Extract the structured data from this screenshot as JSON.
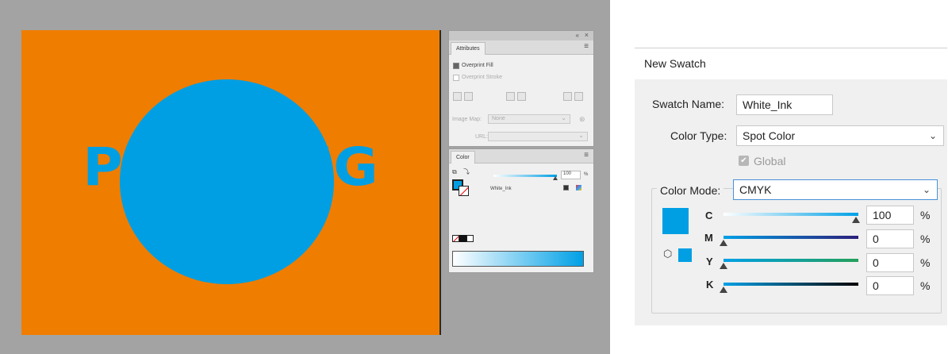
{
  "artwork": {
    "text": "PRINTING"
  },
  "attributes_panel": {
    "collapse_glyph": "«",
    "close_glyph": "×",
    "tab": "Attributes",
    "overprint_fill": "Overprint Fill",
    "overprint_stroke": "Overprint Stroke",
    "image_map_label": "Image Map:",
    "image_map_value": "None",
    "url_label": "URL:"
  },
  "color_panel": {
    "tab": "Color",
    "tint_value": "100",
    "tint_unit": "%",
    "swatch_name": "White_Ink"
  },
  "dialog": {
    "title": "New Swatch",
    "swatch_name_label": "Swatch Name:",
    "swatch_name_value": "White_Ink",
    "color_type_label": "Color Type:",
    "color_type_value": "Spot Color",
    "global_label": "Global",
    "color_mode_label": "Color Mode:",
    "color_mode_value": "CMYK",
    "channels": [
      {
        "label": "C",
        "value": "100",
        "unit": "%"
      },
      {
        "label": "M",
        "value": "0",
        "unit": "%"
      },
      {
        "label": "Y",
        "value": "0",
        "unit": "%"
      },
      {
        "label": "K",
        "value": "0",
        "unit": "%"
      }
    ]
  },
  "colors": {
    "artboard": "#ef7d00",
    "circle_and_text": "#009fe3",
    "workspace": "#a3a3a3"
  }
}
